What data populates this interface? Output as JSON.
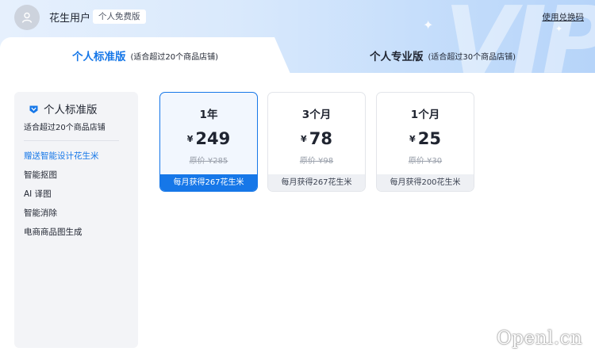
{
  "header": {
    "user_name": "花生用户",
    "plan_badge": "个人免费版",
    "redeem_link": "使用兑换码",
    "background_mark": "VIP"
  },
  "tabs": [
    {
      "title": "个人标准版",
      "subtitle": "(适合超过20个商品店铺)",
      "active": true
    },
    {
      "title": "个人专业版",
      "subtitle": "(适合超过30个商品店铺)",
      "active": false
    }
  ],
  "sidebar": {
    "title": "个人标准版",
    "description": "适合超过20个商品店铺",
    "items": [
      {
        "label": "赠送智能设计花生米",
        "active": true
      },
      {
        "label": "智能抠图",
        "active": false
      },
      {
        "label": "AI 译图",
        "active": false
      },
      {
        "label": "智能消除",
        "active": false
      },
      {
        "label": "电商商品图生成",
        "active": false
      }
    ]
  },
  "plans": [
    {
      "period": "1年",
      "currency": "¥",
      "price": "249",
      "original": "原价 ¥285",
      "bonus": "每月获得267花生米",
      "selected": true
    },
    {
      "period": "3个月",
      "currency": "¥",
      "price": "78",
      "original": "原价 ¥98",
      "bonus": "每月获得267花生米",
      "selected": false
    },
    {
      "period": "1个月",
      "currency": "¥",
      "price": "25",
      "original": "原价 ¥30",
      "bonus": "每月获得200花生米",
      "selected": false
    }
  ],
  "watermark": "Openl.cn",
  "colors": {
    "accent": "#1677e8",
    "header_gradient_start": "#e6f0fd",
    "header_gradient_end": "#b6d4f9",
    "sidebar_bg": "#f3f4f7"
  },
  "icons": {
    "avatar": "user-icon",
    "sidebar_title": "crown-icon"
  }
}
